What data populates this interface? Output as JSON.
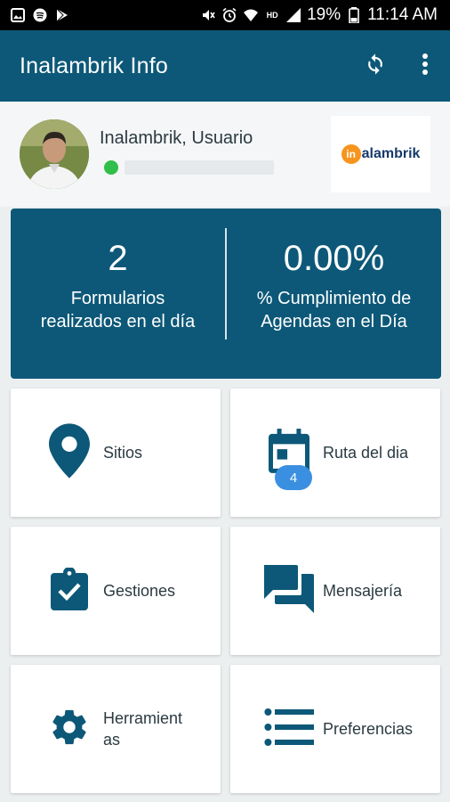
{
  "status_bar": {
    "battery_percent": "19%",
    "time": "11:14 AM",
    "left_icons": [
      "gallery-icon",
      "spotify-icon",
      "play-store-icon"
    ],
    "right_icons": [
      "mute-icon",
      "alarm-icon",
      "wifi-icon",
      "hd-icon",
      "signal-icon",
      "battery-icon"
    ]
  },
  "app_bar": {
    "title": "Inalambrik Info",
    "actions": [
      "sync-icon",
      "more-vert-icon"
    ]
  },
  "profile": {
    "user_name": "Inalambrik, Usuario",
    "progress_fraction": 0.0,
    "status_color": "#2fbf4a",
    "logo": {
      "circle": "in",
      "text": "alambrik"
    }
  },
  "stats": [
    {
      "value": "2",
      "label": "Formularios realizados en el día"
    },
    {
      "value": "0.00%",
      "label": "% Cumplimiento de Agendas en el Día"
    }
  ],
  "menu": {
    "sitios": {
      "label": "Sitios",
      "icon": "location-pin-icon"
    },
    "ruta": {
      "label": "Ruta del dia",
      "icon": "calendar-icon",
      "badge": "4"
    },
    "gestiones": {
      "label": "Gestiones",
      "icon": "clipboard-check-icon"
    },
    "mensajeria": {
      "label": "Mensajería",
      "icon": "chat-icon"
    },
    "herramientas": {
      "label": "Herramient as",
      "icon": "gear-icon"
    },
    "preferencias": {
      "label": "Preferencias",
      "icon": "list-icon"
    }
  },
  "colors": {
    "primary": "#0d5878",
    "icon": "#0d5878",
    "badge": "#3b8fe0",
    "background": "#eceff0"
  }
}
